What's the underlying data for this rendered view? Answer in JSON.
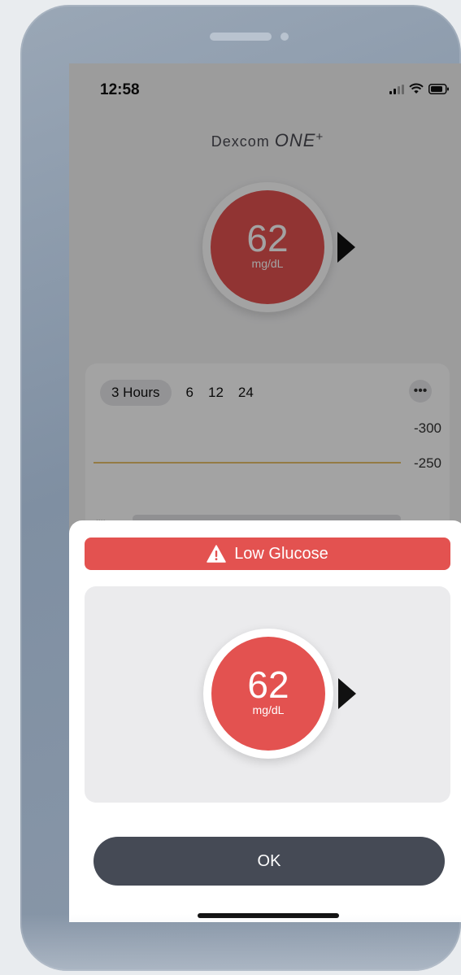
{
  "status": {
    "time": "12:58"
  },
  "brand": {
    "name": "Dexcom",
    "product": "ONE",
    "plus": "+"
  },
  "reading": {
    "value": "62",
    "unit": "mg/dL",
    "trend": "steady-right"
  },
  "graph": {
    "tabs": [
      {
        "label": "3 Hours",
        "selected": true
      },
      {
        "label": "6"
      },
      {
        "label": "12"
      },
      {
        "label": "24"
      }
    ],
    "more_label": "•••",
    "y_labels": [
      "-300",
      "-250"
    ],
    "partial_dots": "••••"
  },
  "alert": {
    "title": "Low Glucose",
    "reading_value": "62",
    "reading_unit": "mg/dL",
    "ok_label": "OK"
  },
  "colors": {
    "alert_red": "#e35250",
    "ok_button": "#454a55",
    "high_line": "#e8c06b"
  }
}
